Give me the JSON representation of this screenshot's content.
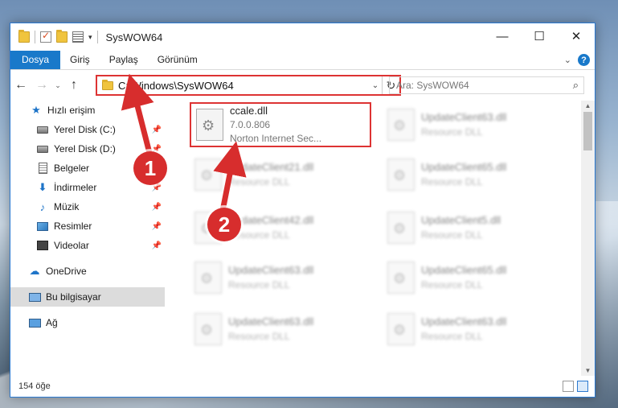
{
  "window": {
    "title": "SysWOW64",
    "controls": {
      "minimize": "—",
      "maximize": "☐",
      "close": "✕"
    }
  },
  "ribbon": {
    "tabs": [
      "Dosya",
      "Giriş",
      "Paylaş",
      "Görünüm"
    ],
    "help": "?"
  },
  "nav": {
    "back": "←",
    "forward": "→",
    "recent": "⌄",
    "up": "↑",
    "address": "C:\\Windows\\SysWOW64",
    "search_placeholder": "Ara: SysWOW64"
  },
  "sidebar": {
    "items": [
      {
        "label": "Hızlı erişim",
        "icon": "star-icon",
        "pinned": false
      },
      {
        "label": "Yerel Disk (C:)",
        "icon": "drive-icon",
        "pinned": true
      },
      {
        "label": "Yerel Disk (D:)",
        "icon": "drive-icon",
        "pinned": true
      },
      {
        "label": "Belgeler",
        "icon": "documents-icon",
        "pinned": true
      },
      {
        "label": "İndirmeler",
        "icon": "download-icon",
        "pinned": true
      },
      {
        "label": "Müzik",
        "icon": "music-icon",
        "pinned": true
      },
      {
        "label": "Resimler",
        "icon": "pictures-icon",
        "pinned": true
      },
      {
        "label": "Videolar",
        "icon": "video-icon",
        "pinned": true
      },
      {
        "label": "OneDrive",
        "icon": "cloud-icon",
        "pinned": false
      },
      {
        "label": "Bu bilgisayar",
        "icon": "computer-icon",
        "pinned": false,
        "selected": true
      },
      {
        "label": "Ağ",
        "icon": "network-icon",
        "pinned": false
      }
    ]
  },
  "files": {
    "highlighted": {
      "name": "ccale.dll",
      "version": "7.0.0.806",
      "company": "Norton Internet Sec..."
    },
    "blurred": [
      {
        "name": "UpdateClient63.dll",
        "type": "Resource DLL"
      },
      {
        "name": "UpdateClient21.dll",
        "type": "Resource DLL"
      },
      {
        "name": "UpdateClient65.dll",
        "type": "Resource DLL"
      },
      {
        "name": "UpdateClient42.dll",
        "type": "Resource DLL"
      },
      {
        "name": "UpdateClient5.dll",
        "type": "Resource DLL"
      },
      {
        "name": "UpdateClient63.dll",
        "type": "Resource DLL"
      },
      {
        "name": "UpdateClient65.dll",
        "type": "Resource DLL"
      },
      {
        "name": "UpdateClient63.dll",
        "type": "Resource DLL"
      },
      {
        "name": "UpdateClient63.dll",
        "type": "Resource DLL"
      }
    ]
  },
  "status": {
    "count": "154 öğe"
  },
  "annotations": {
    "step1": "1",
    "step2": "2",
    "color": "#d72d2d"
  }
}
